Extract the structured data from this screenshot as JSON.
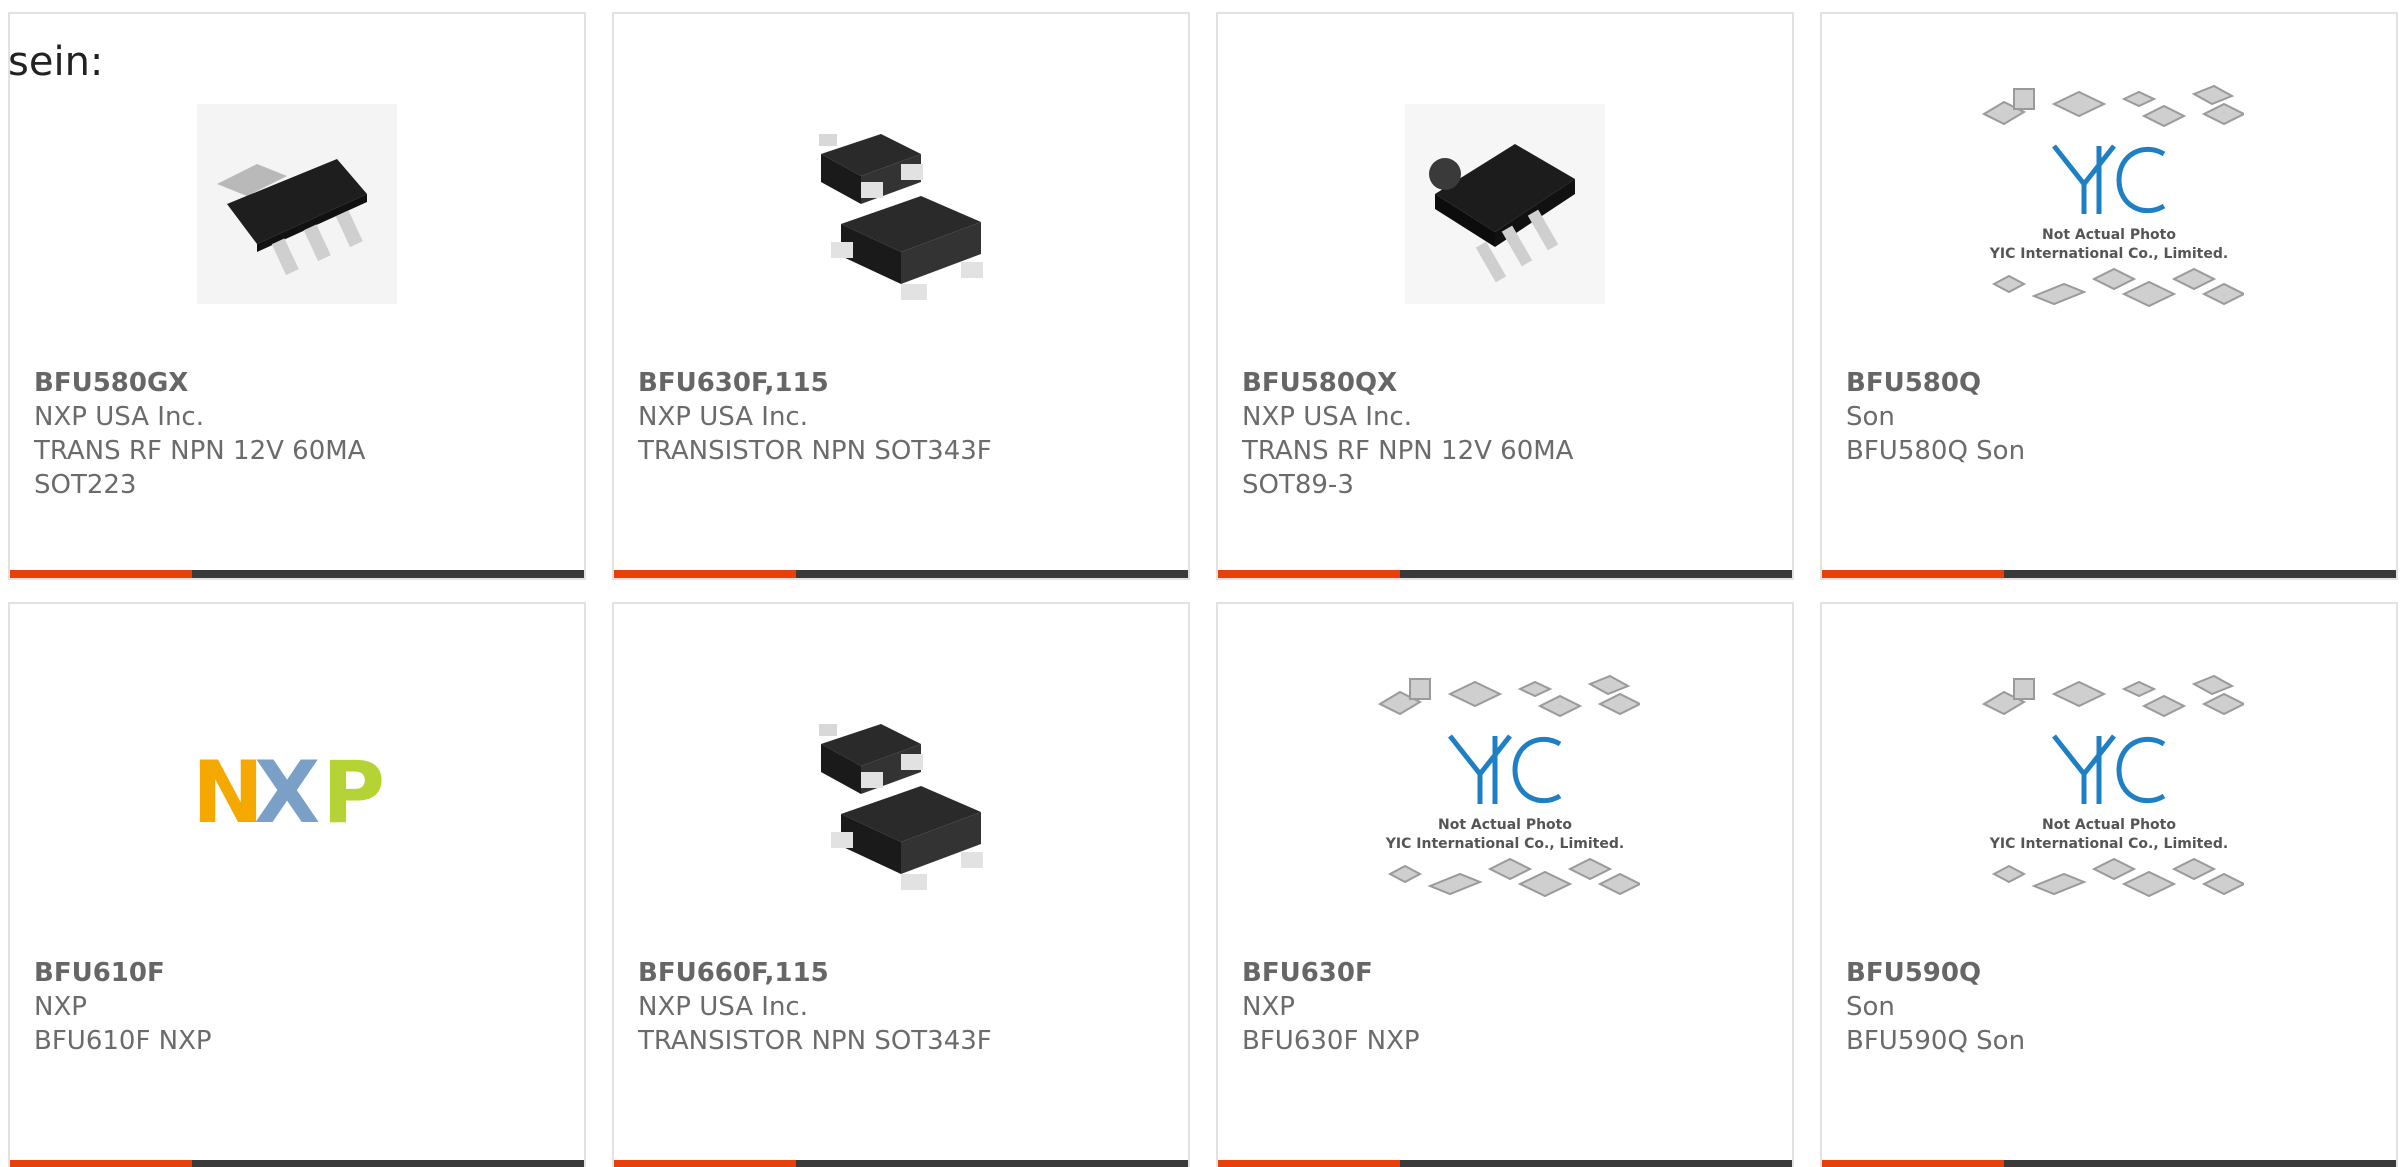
{
  "intro_text": "sein:",
  "colors": {
    "accent": "#e8400a",
    "bar": "#3a3a3a",
    "border": "#e2e2e2",
    "text": "#6b6b6b"
  },
  "cards": [
    {
      "part": "BFU580GX",
      "maker": "NXP USA Inc.",
      "desc": "TRANS RF NPN 12V 60MA SOT223",
      "image": "sot223-package"
    },
    {
      "part": "BFU630F,115",
      "maker": "NXP USA Inc.",
      "desc": "TRANSISTOR NPN SOT343F",
      "image": "sot343f-package"
    },
    {
      "part": "BFU580QX",
      "maker": "NXP USA Inc.",
      "desc": "TRANS RF NPN 12V 60MA SOT89-3",
      "image": "sot89-package"
    },
    {
      "part": "BFU580Q",
      "maker": "Son",
      "desc": "BFU580Q Son",
      "image": "yic-placeholder"
    },
    {
      "part": "BFU610F",
      "maker": "NXP",
      "desc": "BFU610F NXP",
      "image": "nxp-logo"
    },
    {
      "part": "BFU660F,115",
      "maker": "NXP USA Inc.",
      "desc": "TRANSISTOR NPN SOT343F",
      "image": "sot343f-package"
    },
    {
      "part": "BFU630F",
      "maker": "NXP",
      "desc": "BFU630F NXP",
      "image": "yic-placeholder"
    },
    {
      "part": "BFU590Q",
      "maker": "Son",
      "desc": "BFU590Q Son",
      "image": "yic-placeholder"
    }
  ],
  "placeholder": {
    "line1": "Not Actual Photo",
    "line2": "YIC International Co., Limited.",
    "logo": "YIC"
  },
  "nxp_logo": {
    "n": "N",
    "x": "X",
    "p": "P"
  }
}
